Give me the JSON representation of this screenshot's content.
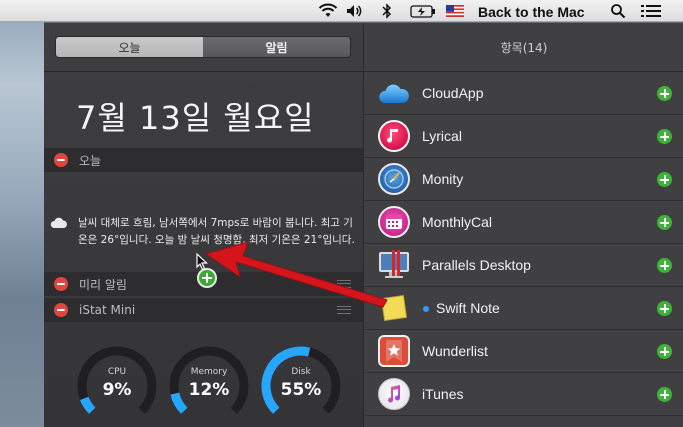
{
  "menubar": {
    "user_label": "Back to the Mac",
    "icons": [
      "wifi-icon",
      "volume-icon",
      "bluetooth-icon",
      "battery-icon",
      "flag-icon",
      "search-icon",
      "list-icon"
    ]
  },
  "left": {
    "tabs": {
      "today": "오늘",
      "notifications": "알림"
    },
    "date": "7월 13일 월요일",
    "sections": {
      "today": "오늘",
      "reminders": "미리 알림",
      "istat": "iStat Mini"
    },
    "weather": "날씨 대체로 흐림, 남서쪽에서 7mps로 바람이 붑니다. 최고 기온은 26°입니다. 오늘 밤 날씨 청명함, 최저 기온은 21°입니다.",
    "gauges": [
      {
        "label": "CPU",
        "value": "9%",
        "fraction": 0.09
      },
      {
        "label": "Memory",
        "value": "12%",
        "fraction": 0.12
      },
      {
        "label": "Disk",
        "value": "55%",
        "fraction": 0.55
      }
    ],
    "colors": {
      "gauge_track": "#1f1f22",
      "gauge_fill": "#27a6ff"
    }
  },
  "right": {
    "title": "항목(14)",
    "items": [
      {
        "label": "CloudApp",
        "icon": "cloudapp-icon"
      },
      {
        "label": "Lyrical",
        "icon": "lyrical-icon"
      },
      {
        "label": "Monity",
        "icon": "monity-icon"
      },
      {
        "label": "MonthlyCal",
        "icon": "monthlycal-icon"
      },
      {
        "label": "Parallels Desktop",
        "icon": "parallels-icon"
      },
      {
        "label": "Swift Note",
        "icon": "swift-note-icon"
      },
      {
        "label": "Wunderlist",
        "icon": "wunderlist-icon"
      },
      {
        "label": "iTunes",
        "icon": "itunes-icon"
      }
    ]
  },
  "colors": {
    "add": "#3fb339",
    "remove": "#e0453e",
    "arrow": "#d4161c"
  }
}
